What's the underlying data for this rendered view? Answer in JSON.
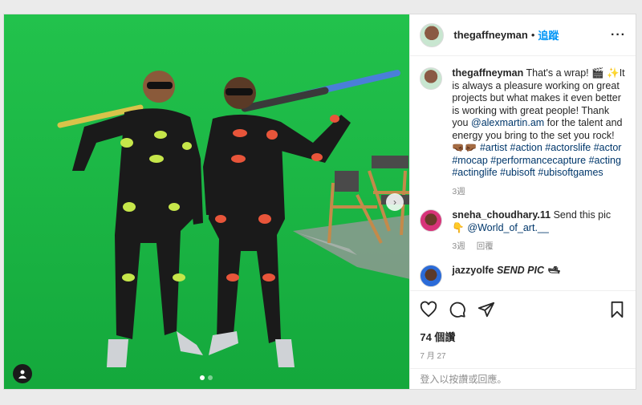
{
  "post": {
    "author": "thegaffneyman",
    "separator": "•",
    "follow_label": "追蹤",
    "more_label": "···",
    "caption_text": "That's a wrap! 🎬 ✨It is always a pleasure working on great projects but what makes it even better is working with great people! Thank you",
    "caption_mention": "@alexmartin.am",
    "caption_text2": "for the talent and energy you bring to the set you rock! 🤜🏾🤛🏾",
    "caption_hashtags": "#artist #action #actorslife #actor #mocap #performancecapture #acting #actinglife #ubisoft #ubisoftgames",
    "caption_time": "3週"
  },
  "comments": [
    {
      "user": "sneha_choudhary.11",
      "text": "Send this pic 👇",
      "mention": "@World_of_art.__",
      "time": "3週",
      "reply_label": "回覆"
    },
    {
      "user": "jazzyolfe",
      "text": "SEND PIC 🛥"
    }
  ],
  "likes": "74 個讚",
  "date": "7 月 27",
  "login_prompt": "登入以按讚或回應。",
  "carousel": {
    "count": 2,
    "active": 0
  },
  "colors": {
    "accent": "#0095f6",
    "link": "#00376b",
    "greenscreen": "#1fbf48"
  },
  "icons": [
    "heart-icon",
    "comment-icon",
    "share-icon",
    "bookmark-icon",
    "user-tag-icon",
    "more-icon"
  ]
}
